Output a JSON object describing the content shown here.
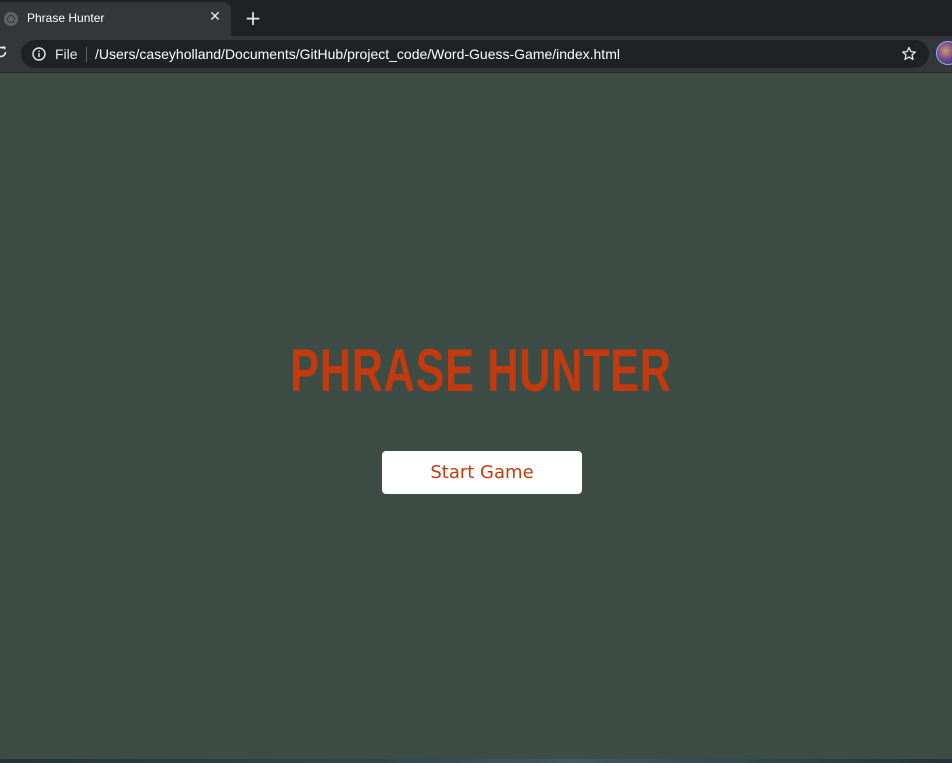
{
  "browser": {
    "tab": {
      "title": "Phrase Hunter",
      "favicon": "globe-icon",
      "close_glyph": "✕"
    },
    "new_tab_glyph": "+",
    "omnibox": {
      "scheme_label": "File",
      "url": "/Users/caseyholland/Documents/GitHub/project_code/Word-Guess-Game/index.html"
    }
  },
  "page": {
    "title": "PHRASE HUNTER",
    "start_button_label": "Start Game",
    "colors": {
      "background": "#3d4d45",
      "accent": "#c23a0e",
      "button_background": "#ffffff"
    }
  }
}
